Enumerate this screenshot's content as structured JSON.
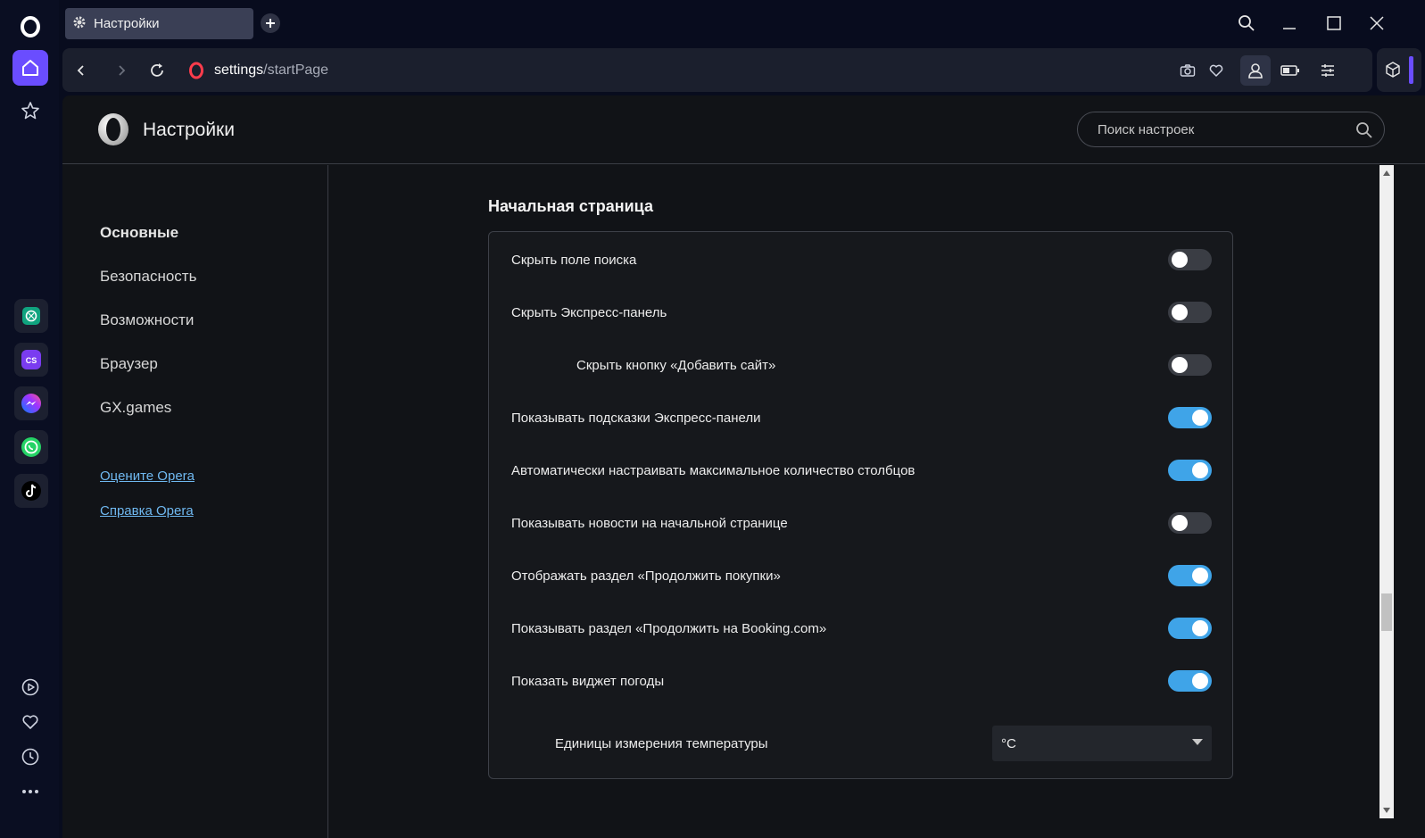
{
  "browser": {
    "tab_title": "Настройки",
    "url_host": "settings",
    "url_path": "/startPage"
  },
  "settings": {
    "header_title": "Настройки",
    "search_placeholder": "Поиск настроек",
    "nav": [
      {
        "label": "Основные",
        "active": true
      },
      {
        "label": "Безопасность",
        "active": false
      },
      {
        "label": "Возможности",
        "active": false
      },
      {
        "label": "Браузер",
        "active": false
      },
      {
        "label": "GX.games",
        "active": false
      }
    ],
    "links": [
      {
        "label": "Оцените Opera"
      },
      {
        "label": "Справка Opera"
      }
    ],
    "section_title": "Начальная страница",
    "rows": [
      {
        "label": "Скрыть поле поиска",
        "on": false,
        "indent": false
      },
      {
        "label": "Скрыть Экспресс-панель",
        "on": false,
        "indent": false
      },
      {
        "label": "Скрыть кнопку «Добавить сайт»",
        "on": false,
        "indent": true
      },
      {
        "label": "Показывать подсказки Экспресс-панели",
        "on": true,
        "indent": false
      },
      {
        "label": "Автоматически настраивать максимальное количество столбцов",
        "on": true,
        "indent": false
      },
      {
        "label": "Показывать новости на начальной странице",
        "on": false,
        "indent": false
      },
      {
        "label": "Отображать раздел «Продолжить покупки»",
        "on": true,
        "indent": false
      },
      {
        "label": "Показывать раздел «Продолжить на Booking.com»",
        "on": true,
        "indent": false
      },
      {
        "label": "Показать виджет погоды",
        "on": true,
        "indent": false
      }
    ],
    "temperature": {
      "label": "Единицы измерения температуры",
      "value": "°C"
    }
  },
  "sidebar_apps": [
    "chatgpt-icon",
    "cs-icon",
    "messenger-icon",
    "whatsapp-icon",
    "tiktok-icon"
  ],
  "colors": {
    "accent": "#6a4dff",
    "toggle_on": "#3fa4e8",
    "link": "#6fb8f0"
  }
}
